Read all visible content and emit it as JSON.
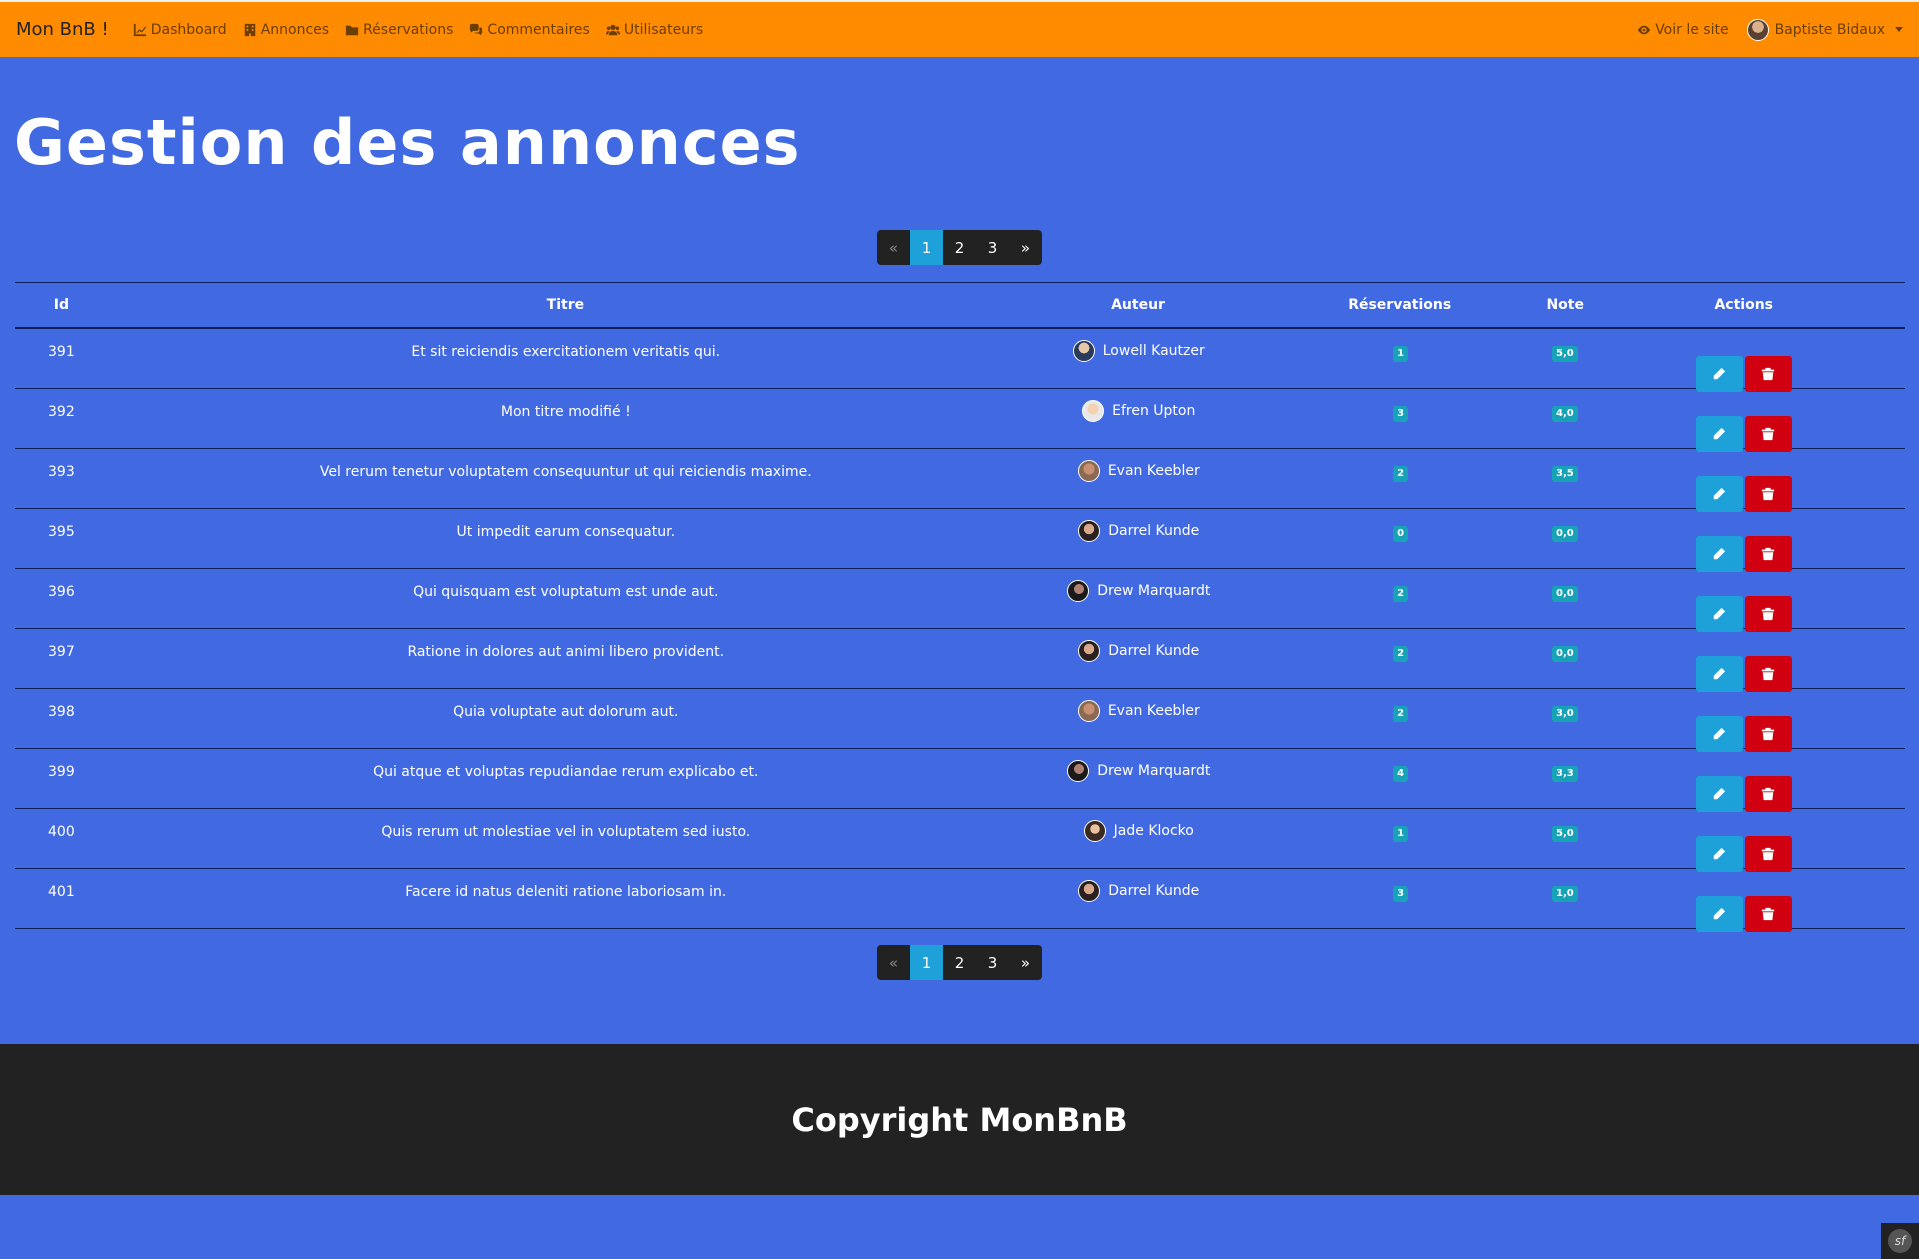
{
  "brand": "Mon BnB !",
  "nav": {
    "items": [
      {
        "label": "Dashboard",
        "icon": "chart-line-icon"
      },
      {
        "label": "Annonces",
        "icon": "building-icon"
      },
      {
        "label": "Réservations",
        "icon": "folder-icon"
      },
      {
        "label": "Commentaires",
        "icon": "comments-icon"
      },
      {
        "label": "Utilisateurs",
        "icon": "users-icon"
      }
    ],
    "view_site": "Voir le site",
    "user_name": "Baptiste Bidaux"
  },
  "page_title": "Gestion des annonces",
  "pagination": {
    "prev": "«",
    "pages": [
      "1",
      "2",
      "3"
    ],
    "next": "»",
    "active": "1"
  },
  "table": {
    "headers": [
      "Id",
      "Titre",
      "Auteur",
      "Réservations",
      "Note",
      "Actions"
    ],
    "rows": [
      {
        "id": "391",
        "title": "Et sit reiciendis exercitationem veritatis qui.",
        "author": "Lowell Kautzer",
        "reservations": "1",
        "note": "5,0"
      },
      {
        "id": "392",
        "title": "Mon titre modifié !",
        "author": "Efren Upton",
        "reservations": "3",
        "note": "4,0"
      },
      {
        "id": "393",
        "title": "Vel rerum tenetur voluptatem consequuntur ut qui reiciendis maxime.",
        "author": "Evan Keebler",
        "reservations": "2",
        "note": "3,5"
      },
      {
        "id": "395",
        "title": "Ut impedit earum consequatur.",
        "author": "Darrel Kunde",
        "reservations": "0",
        "note": "0,0"
      },
      {
        "id": "396",
        "title": "Qui quisquam est voluptatum est unde aut.",
        "author": "Drew Marquardt",
        "reservations": "2",
        "note": "0,0"
      },
      {
        "id": "397",
        "title": "Ratione in dolores aut animi libero provident.",
        "author": "Darrel Kunde",
        "reservations": "2",
        "note": "0,0"
      },
      {
        "id": "398",
        "title": "Quia voluptate aut dolorum aut.",
        "author": "Evan Keebler",
        "reservations": "2",
        "note": "3,0"
      },
      {
        "id": "399",
        "title": "Qui atque et voluptas repudiandae rerum explicabo et.",
        "author": "Drew Marquardt",
        "reservations": "4",
        "note": "3,3"
      },
      {
        "id": "400",
        "title": "Quis rerum ut molestiae vel in voluptatem sed iusto.",
        "author": "Jade Klocko",
        "reservations": "1",
        "note": "5,0"
      },
      {
        "id": "401",
        "title": "Facere id natus deleniti ratione laboriosam in.",
        "author": "Darrel Kunde",
        "reservations": "3",
        "note": "1,0"
      }
    ]
  },
  "footer": "Copyright MonBnB",
  "colors": {
    "navbar": "#ff8c00",
    "background": "#4169e1",
    "active_page": "#1ea0d8",
    "edit": "#1ea0d8",
    "delete": "#d00010",
    "badge": "#17a2b8",
    "footer": "#222222"
  }
}
